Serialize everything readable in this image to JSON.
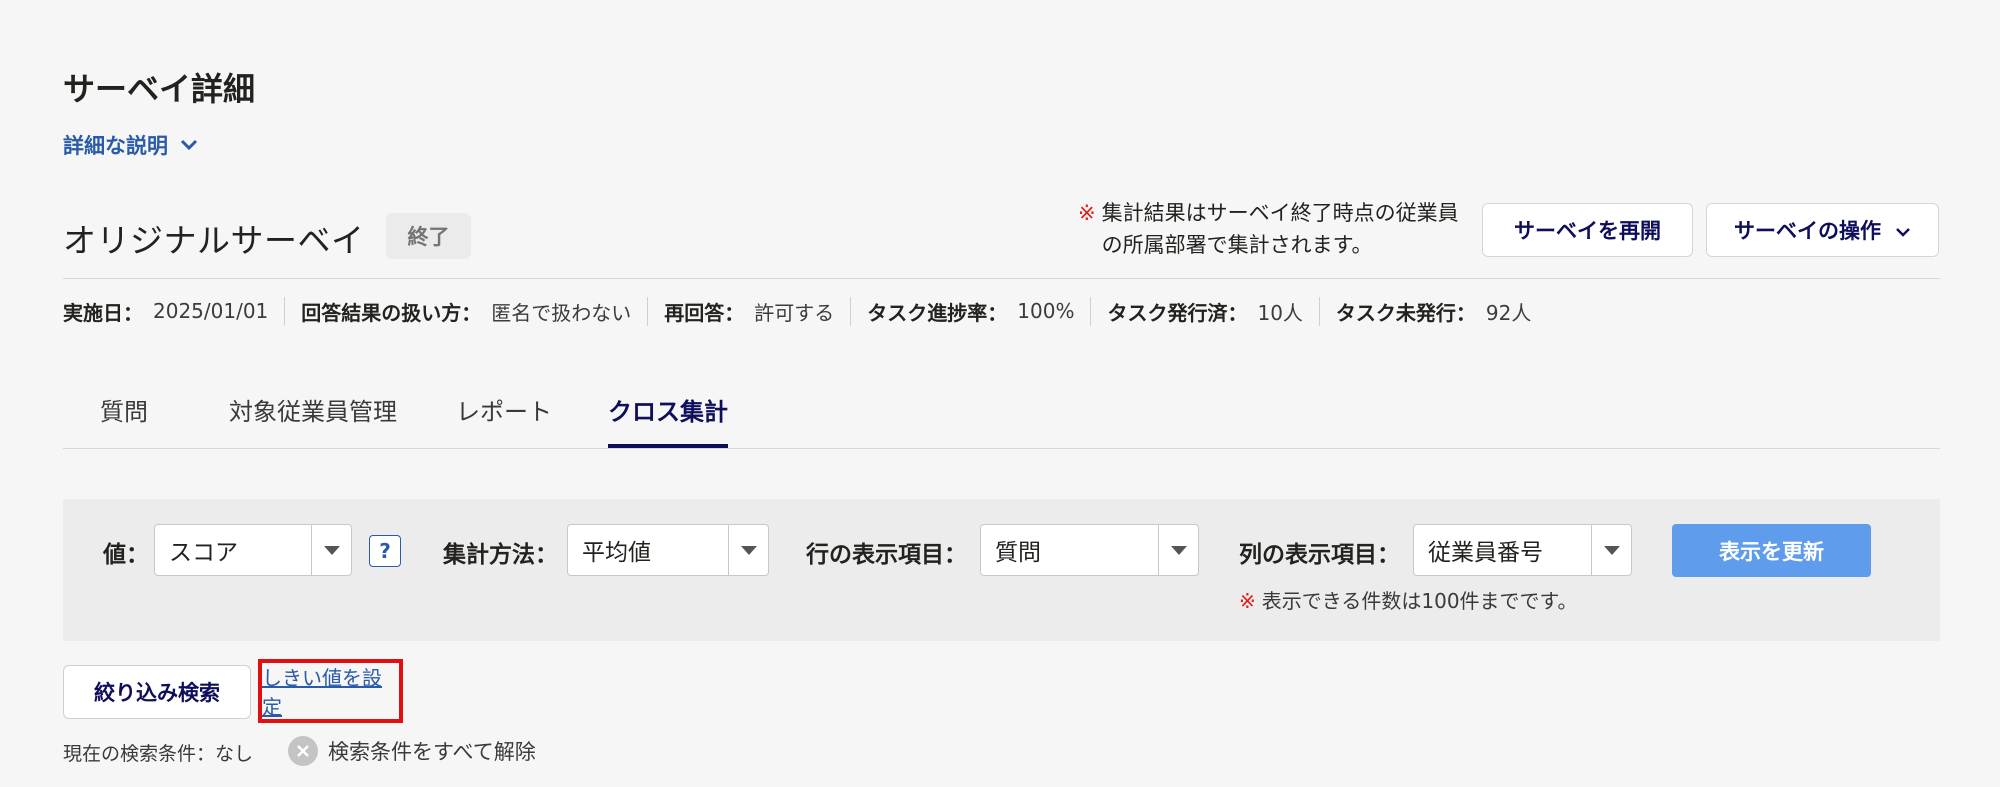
{
  "page": {
    "title": "サーベイ詳細",
    "description_toggle": "詳細な説明"
  },
  "survey": {
    "name": "オリジナルサーベイ",
    "status": "終了",
    "notice_mark": "※",
    "notice": "集計結果はサーベイ終了時点の従業員の所属部署で集計されます。",
    "reopen_button": "サーベイを再開",
    "operations_button": "サーベイの操作"
  },
  "meta": [
    {
      "label": "実施日：",
      "value": "2025/01/01"
    },
    {
      "label": "回答結果の扱い方：",
      "value": "匿名で扱わない"
    },
    {
      "label": "再回答：",
      "value": "許可する"
    },
    {
      "label": "タスク進捗率：",
      "value": "100%"
    },
    {
      "label": "タスク発行済：",
      "value": "10人"
    },
    {
      "label": "タスク未発行：",
      "value": "92人"
    }
  ],
  "tabs": [
    {
      "label": "質問",
      "active": false
    },
    {
      "label": "対象従業員管理",
      "active": false
    },
    {
      "label": "レポート",
      "active": false
    },
    {
      "label": "クロス集計",
      "active": true
    }
  ],
  "filters": {
    "value_label": "値：",
    "value_selected": "スコア",
    "help_icon": "?",
    "method_label": "集計方法：",
    "method_selected": "平均値",
    "row_label": "行の表示項目：",
    "row_selected": "質問",
    "col_label": "列の表示項目：",
    "col_selected": "従業員番号",
    "update_button": "表示を更新",
    "limit_mark": "※",
    "limit_note": "表示できる件数は100件までです。"
  },
  "search": {
    "narrow_button": "絞り込み検索",
    "threshold_link": "しきい値を設定",
    "current_condition": "現在の検索条件：なし",
    "clear_all": "検索条件をすべて解除"
  },
  "colors": {
    "accent_navy": "#0e0e5a",
    "link_blue": "#2a5ba8",
    "update_button": "#5f9cec",
    "highlight_red": "#e01010"
  }
}
